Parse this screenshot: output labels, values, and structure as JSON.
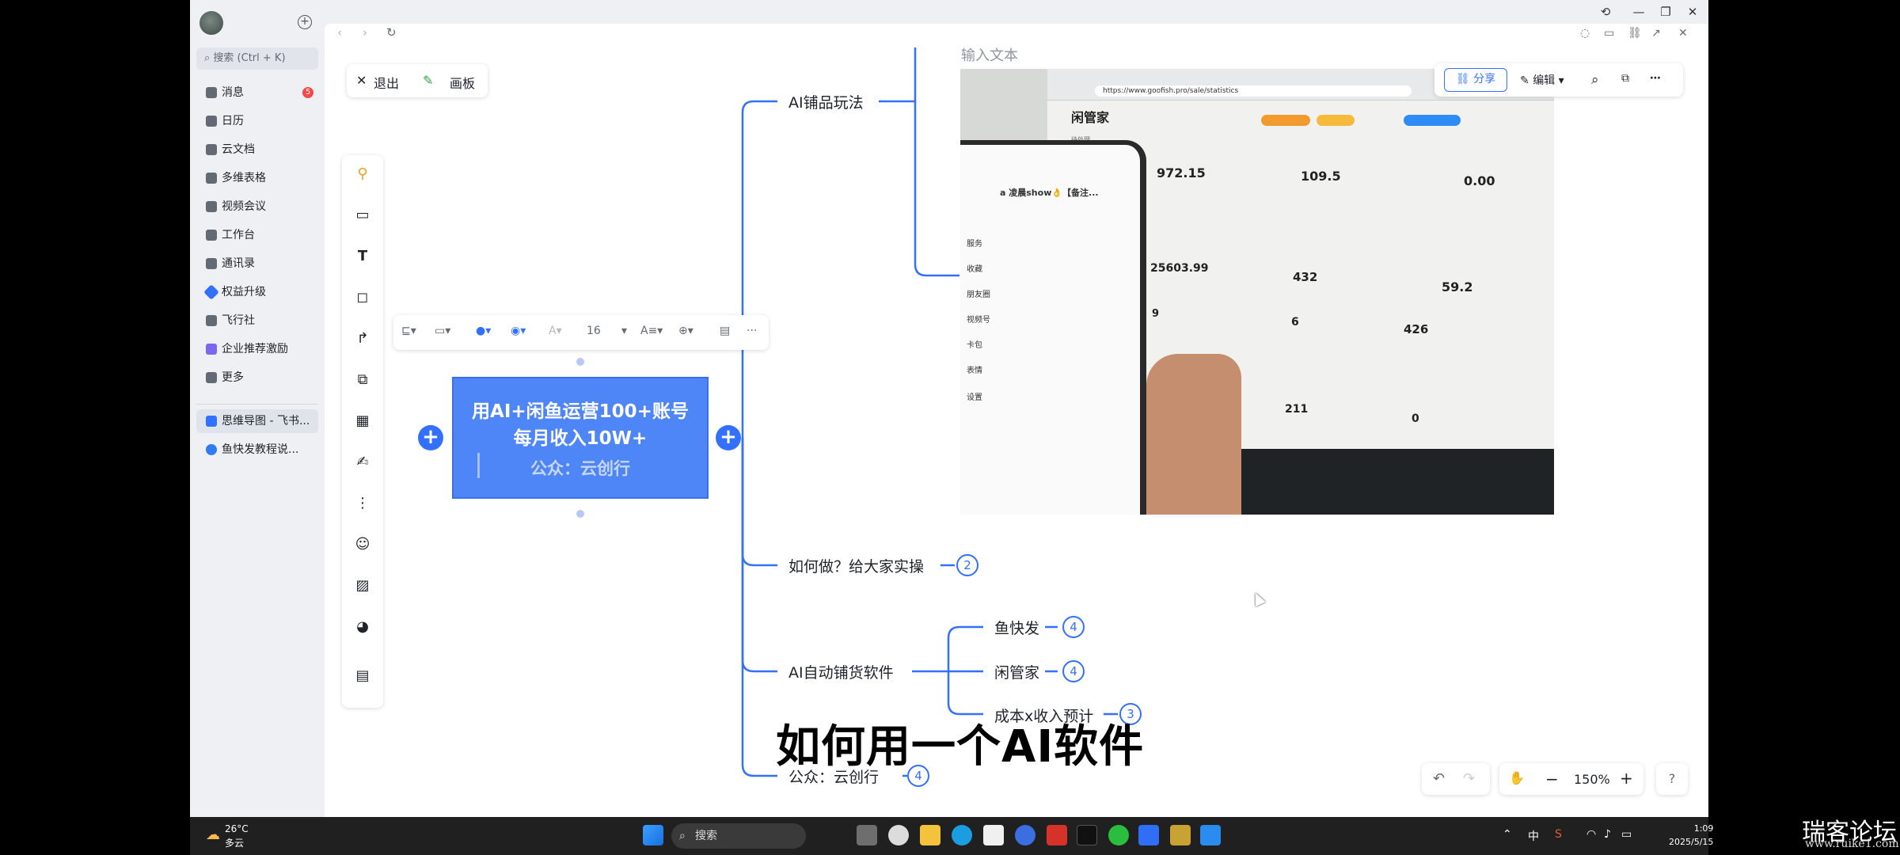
{
  "sidebar": {
    "search_placeholder": "搜索 (Ctrl + K)",
    "items": [
      {
        "label": "消息",
        "badge": "5"
      },
      {
        "label": "日历"
      },
      {
        "label": "云文档"
      },
      {
        "label": "多维表格"
      },
      {
        "label": "视频会议"
      },
      {
        "label": "工作台"
      },
      {
        "label": "通讯录"
      },
      {
        "label": "权益升级"
      },
      {
        "label": "飞行社"
      },
      {
        "label": "企业推荐激励"
      },
      {
        "label": "更多"
      }
    ],
    "open_docs": [
      {
        "label": "思维导图 - 飞书..."
      },
      {
        "label": "鱼快发教程说..."
      }
    ]
  },
  "whiteboard": {
    "exit_label": "退出",
    "board_label": "画板",
    "share_label": "分享",
    "edit_label": "编辑",
    "font_size": "16",
    "zoom": "150%",
    "input_hint": "输入文本"
  },
  "mindmap": {
    "central": {
      "line1": "用AI+闲鱼运营100+账号",
      "line2": "每月收入10W+",
      "line3": "公众：云创行"
    },
    "branches": [
      {
        "label": "AI铺品玩法"
      },
      {
        "label": "如何做？给大家实操",
        "count": "2"
      },
      {
        "label": "AI自动铺货软件",
        "children": [
          {
            "label": "鱼快发",
            "count": "4"
          },
          {
            "label": "闲管家",
            "count": "4"
          },
          {
            "label": "成本x收入预计",
            "count": "3"
          }
        ]
      },
      {
        "label": "公众：云创行",
        "count": "4"
      }
    ]
  },
  "photo": {
    "url": "https://www.goofish.pro/sale/statistics",
    "brand": "闲管家",
    "section": "待处理",
    "stats": [
      "972.15",
      "109.5",
      "0.00",
      "25603.99",
      "432",
      "59.2",
      "9",
      "6",
      "426",
      "211",
      "0"
    ],
    "phone_user": "a 凌晨show👌【备注...",
    "phone_items": [
      "服务",
      "收藏",
      "朋友圈",
      "视频号",
      "卡包",
      "表情",
      "设置"
    ]
  },
  "subtitle": "如何用一个AI软件",
  "taskbar": {
    "temp": "26°C",
    "weather": "多云",
    "search": "搜索",
    "ime": "中",
    "time": "1:09",
    "date": "2025/5/15"
  },
  "watermark": {
    "title": "瑞客论坛",
    "url": "www.ruike1.com"
  }
}
